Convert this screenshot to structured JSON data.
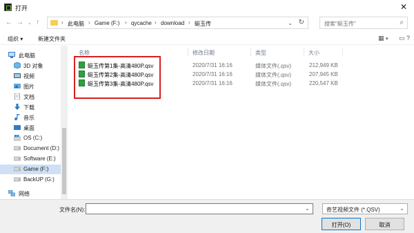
{
  "window": {
    "title": "打开"
  },
  "nav": {
    "breadcrumb": [
      "此电脑",
      "Game (F:)",
      "qycache",
      "download",
      "蜓玉传"
    ],
    "separator": "›",
    "search_placeholder": "搜索\"蜓玉传\""
  },
  "toolbar": {
    "organize": "组织 ▾",
    "new_folder": "新建文件夹"
  },
  "sidebar": {
    "items": [
      {
        "label": "此电脑",
        "icon": "computer-icon"
      },
      {
        "label": "3D 对象",
        "icon": "cube-icon"
      },
      {
        "label": "视频",
        "icon": "video-icon"
      },
      {
        "label": "图片",
        "icon": "picture-icon"
      },
      {
        "label": "文档",
        "icon": "document-icon"
      },
      {
        "label": "下载",
        "icon": "download-arrow-icon"
      },
      {
        "label": "音乐",
        "icon": "music-note-icon"
      },
      {
        "label": "桌面",
        "icon": "desktop-icon"
      },
      {
        "label": "OS (C:)",
        "icon": "drive-icon"
      },
      {
        "label": "Document (D:)",
        "icon": "drive-icon"
      },
      {
        "label": "Software (E:)",
        "icon": "drive-icon"
      },
      {
        "label": "Game (F:)",
        "icon": "drive-icon"
      },
      {
        "label": "BackUP (G:)",
        "icon": "drive-icon"
      },
      {
        "label": "网络",
        "icon": "network-icon"
      }
    ]
  },
  "columns": {
    "name": "名称",
    "modified": "修改日期",
    "type": "类型",
    "size": "大小"
  },
  "files": [
    {
      "name": "蜓玉传第1集-高清480P.qsv",
      "modified": "2020/7/31 16:16",
      "type": "媒体文件(.qsv)",
      "size": "212,949 KB"
    },
    {
      "name": "蜓玉传第2集-高清480P.qsv",
      "modified": "2020/7/31 16:16",
      "type": "媒体文件(.qsv)",
      "size": "207,945 KB"
    },
    {
      "name": "蜓玉传第3集-高清480P.qsv",
      "modified": "2020/7/31 16:16",
      "type": "媒体文件(.qsv)",
      "size": "220,547 KB"
    }
  ],
  "footer": {
    "filename_label": "文件名(N):",
    "filename_value": "",
    "filetype_value": "奇艺视频文件 (*.QSV)",
    "open_button": "打开(O)",
    "cancel_button": "取消"
  },
  "colors": {
    "highlight_box": "#d71f1f",
    "selected_row": "#cde0f5",
    "file_icon": "#2f9f3f"
  }
}
